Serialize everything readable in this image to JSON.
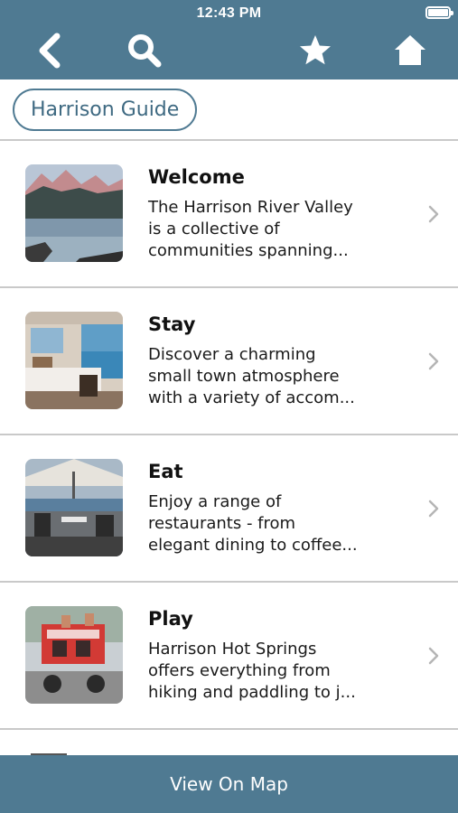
{
  "status_bar": {
    "time": "12:43 PM"
  },
  "toolbar": {
    "icons": [
      "back-icon",
      "search-icon",
      "star-icon",
      "home-icon"
    ],
    "accent_color": "#4f7a92"
  },
  "guide": {
    "chip_label": "Harrison Guide"
  },
  "items": [
    {
      "title": "Welcome",
      "description": "The Harrison River Valley\nis a collective of\ncommunities spanning..."
    },
    {
      "title": "Stay",
      "description": "Discover a charming\nsmall town atmosphere\nwith a variety of accom..."
    },
    {
      "title": "Eat",
      "description": "Enjoy a range of\nrestaurants - from\nelegant dining to coffee..."
    },
    {
      "title": "Play",
      "description": "Harrison Hot Springs\noffers everything from\nhiking and paddling to j..."
    }
  ],
  "footer": {
    "map_label": "View On Map"
  }
}
